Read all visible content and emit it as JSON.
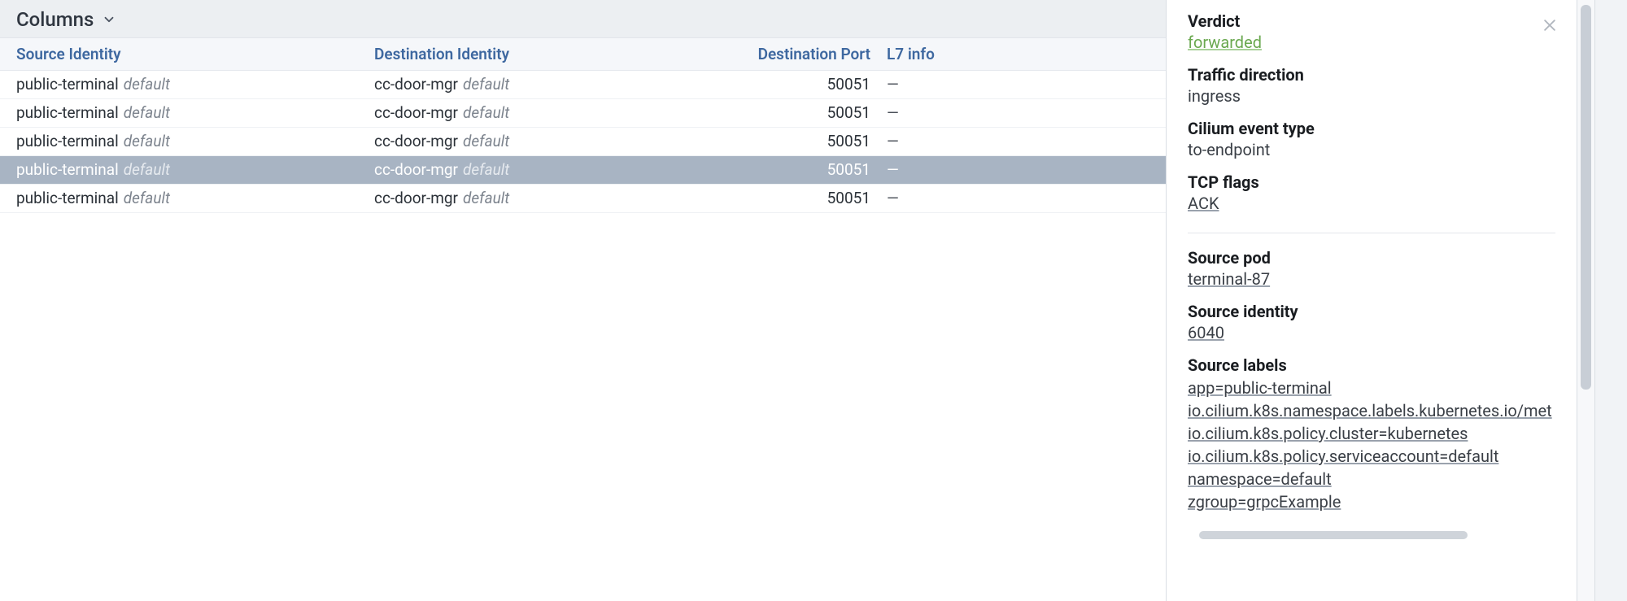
{
  "toolbar": {
    "columns_label": "Columns"
  },
  "table": {
    "headers": {
      "source": "Source Identity",
      "destination": "Destination Identity",
      "port": "Destination Port",
      "l7": "L7 info"
    },
    "rows": [
      {
        "src": "public-terminal",
        "src_ns": "default",
        "dst": "cc-door-mgr",
        "dst_ns": "default",
        "port": "50051",
        "l7": "—",
        "selected": false
      },
      {
        "src": "public-terminal",
        "src_ns": "default",
        "dst": "cc-door-mgr",
        "dst_ns": "default",
        "port": "50051",
        "l7": "—",
        "selected": false
      },
      {
        "src": "public-terminal",
        "src_ns": "default",
        "dst": "cc-door-mgr",
        "dst_ns": "default",
        "port": "50051",
        "l7": "—",
        "selected": false
      },
      {
        "src": "public-terminal",
        "src_ns": "default",
        "dst": "cc-door-mgr",
        "dst_ns": "default",
        "port": "50051",
        "l7": "—",
        "selected": true
      },
      {
        "src": "public-terminal",
        "src_ns": "default",
        "dst": "cc-door-mgr",
        "dst_ns": "default",
        "port": "50051",
        "l7": "—",
        "selected": false
      }
    ]
  },
  "details": {
    "verdict_label": "Verdict",
    "verdict_value": "forwarded",
    "traffic_dir_label": "Traffic direction",
    "traffic_dir_value": "ingress",
    "event_type_label": "Cilium event type",
    "event_type_value": "to-endpoint",
    "tcp_flags_label": "TCP flags",
    "tcp_flags_value": "ACK",
    "source_pod_label": "Source pod",
    "source_pod_value": "terminal-87",
    "source_identity_label": "Source identity",
    "source_identity_value": "6040",
    "source_labels_label": "Source labels",
    "source_labels": [
      "app=public-terminal",
      "io.cilium.k8s.namespace.labels.kubernetes.io/met",
      "io.cilium.k8s.policy.cluster=kubernetes",
      "io.cilium.k8s.policy.serviceaccount=default",
      "namespace=default",
      "zgroup=grpcExample"
    ]
  }
}
